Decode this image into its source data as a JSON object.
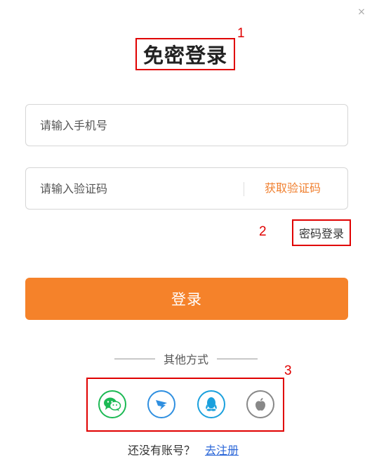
{
  "dialog": {
    "close_symbol": "×",
    "title": "免密登录"
  },
  "form": {
    "phone_placeholder": "请输入手机号",
    "code_placeholder": "请输入验证码",
    "get_code_label": "获取验证码",
    "password_login_label": "密码登录",
    "login_button_label": "登录"
  },
  "other_methods": {
    "label": "其他方式",
    "icons": [
      "wechat-icon",
      "dingtalk-icon",
      "qq-icon",
      "apple-icon"
    ]
  },
  "footer": {
    "no_account_text": "还没有账号？",
    "register_link": "去注册"
  },
  "annotations": {
    "n1": "1",
    "n2": "2",
    "n3": "3"
  },
  "colors": {
    "accent": "#f5822a",
    "link": "#2a66d8",
    "wechat": "#1cb954",
    "dingtalk": "#2f8fe0",
    "qq": "#1aa0dd",
    "apple": "#888888",
    "annotation": "#e00000"
  }
}
